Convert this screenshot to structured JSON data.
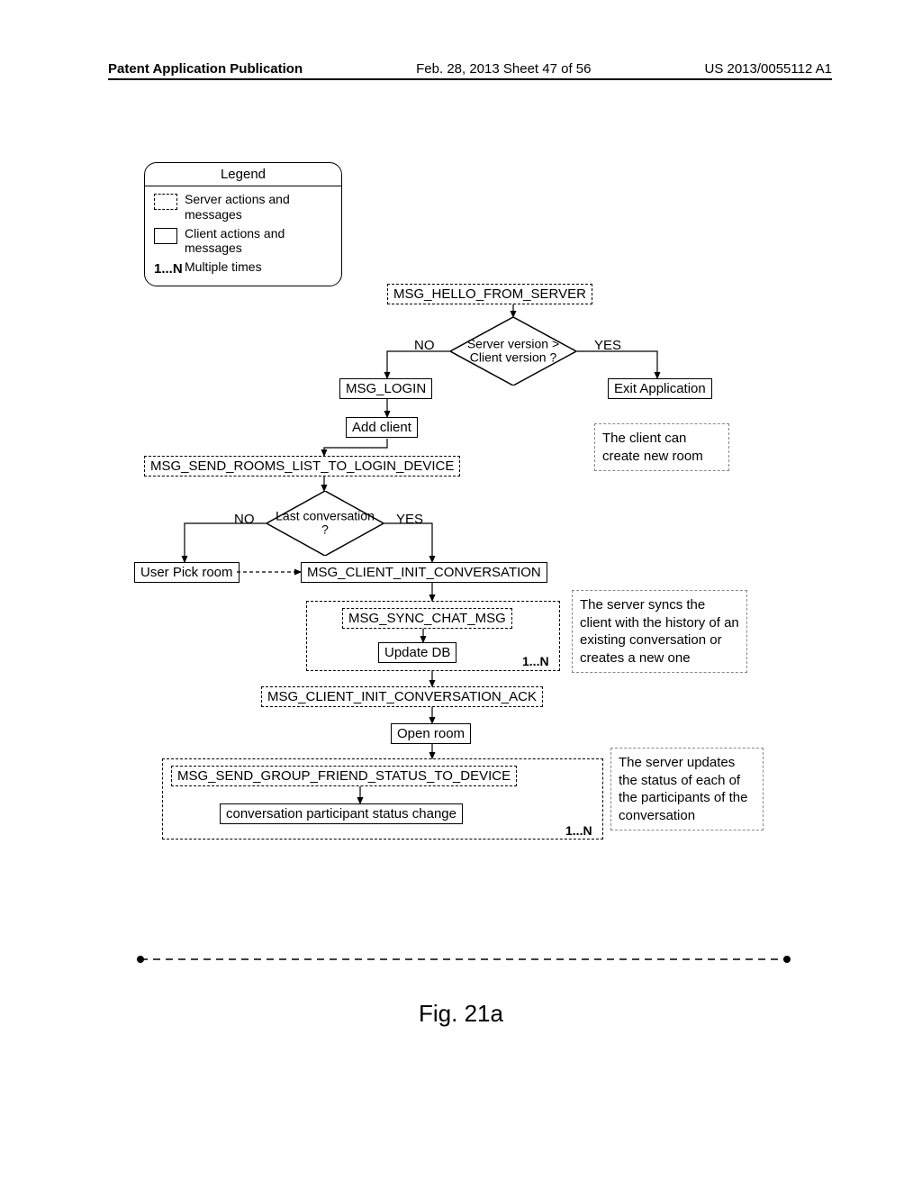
{
  "header": {
    "left": "Patent Application Publication",
    "mid": "Feb. 28, 2013  Sheet 47 of 56",
    "right": "US 2013/0055112 A1"
  },
  "legend": {
    "title": "Legend",
    "server": "Server actions and messages",
    "client": "Client actions and messages",
    "multi_label": "1...N",
    "multi": "Multiple times"
  },
  "nodes": {
    "hello": "MSG_HELLO_FROM_SERVER",
    "decision_version": "Server version > Client version ?",
    "no1": "NO",
    "yes1": "YES",
    "exit": "Exit Application",
    "login": "MSG_LOGIN",
    "addclient": "Add client",
    "rooms_list": "MSG_SEND_ROOMS_LIST_TO_LOGIN_DEVICE",
    "note_create": "The client can create new room",
    "decision_last": "Last conversation ?",
    "no2": "NO",
    "yes2": "YES",
    "pick_room": "User Pick room",
    "init_conv": "MSG_CLIENT_INIT_CONVERSATION",
    "sync_chat": "MSG_SYNC_CHAT_MSG",
    "update_db": "Update DB",
    "loop1n_1": "1...N",
    "note_sync": "The server syncs the client with the history of an existing conversation or creates a new one",
    "init_ack": "MSG_CLIENT_INIT_CONVERSATION_ACK",
    "open_room": "Open room",
    "group_status": "MSG_SEND_GROUP_FRIEND_STATUS_TO_DEVICE",
    "participant_change": "conversation participant status change",
    "loop1n_2": "1...N",
    "note_status": "The server updates the status of each of the participants of the conversation"
  },
  "figure": "Fig. 21a"
}
